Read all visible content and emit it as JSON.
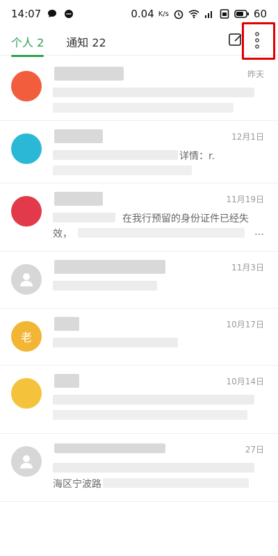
{
  "status_bar": {
    "time": "14:07",
    "network_speed": "0.04",
    "network_unit": "K/s",
    "battery": "60"
  },
  "header": {
    "tabs": [
      {
        "label": "个人 2",
        "active": true
      },
      {
        "label": "通知 22",
        "active": false
      }
    ],
    "accent_color": "#2aa150",
    "highlight_color": "#e00000"
  },
  "messages": [
    {
      "avatar_color": "#f25d3d",
      "avatar_label": "",
      "date": "昨天",
      "line1": "",
      "line2": ""
    },
    {
      "avatar_color": "#2bb8d6",
      "avatar_label": "",
      "date": "12月1日",
      "line1": "详情：r.",
      "line2": ""
    },
    {
      "avatar_color": "#e23a4b",
      "avatar_label": "",
      "date": "11月19日",
      "line1": "在我行预留的身份证件已经失",
      "line2": "效，"
    },
    {
      "avatar_color": "#d7d7d7",
      "avatar_label": "",
      "date": "11月3日",
      "line1": "",
      "line2": ""
    },
    {
      "avatar_color": "#f2b534",
      "avatar_label": "老",
      "date": "10月17日",
      "line1": "",
      "line2": ""
    },
    {
      "avatar_color": "#f5c23b",
      "avatar_label": "",
      "date": "10月14日",
      "line1": "",
      "line2": ""
    },
    {
      "avatar_color": "#d7d7d7",
      "avatar_label": "",
      "date": "27日",
      "line1": "",
      "line2": "海区宁波路"
    }
  ]
}
